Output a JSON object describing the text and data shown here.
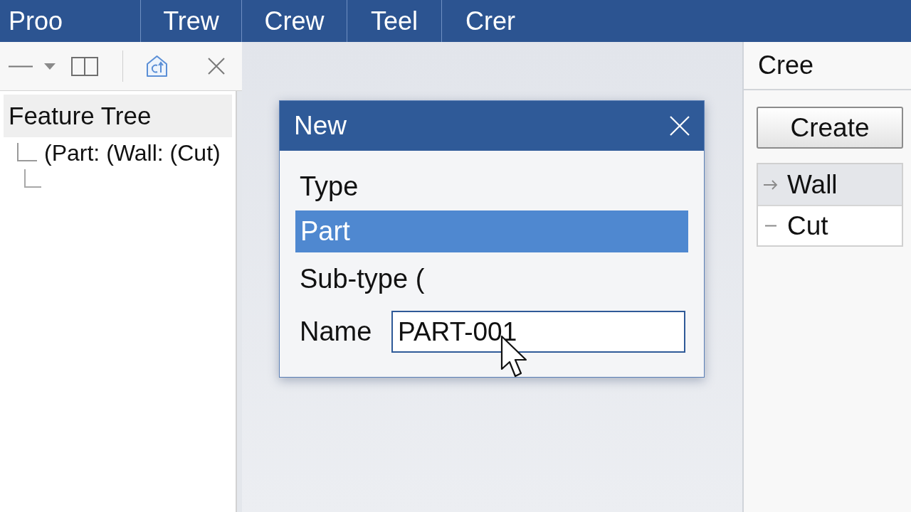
{
  "menu_bar": {
    "items": [
      {
        "label": "Proo"
      },
      {
        "label": "Trew"
      },
      {
        "label": "Crew"
      },
      {
        "label": "Teel"
      },
      {
        "label": "Crer"
      }
    ]
  },
  "feature_tree": {
    "title": "Feature Tree",
    "items": [
      {
        "label": "(Part: (Wall: (Cut)"
      }
    ]
  },
  "dialog": {
    "title": "New",
    "type": {
      "label": "Type",
      "options": [
        {
          "label": "Part",
          "selected": true
        }
      ]
    },
    "subtype": {
      "label": "Sub-type ("
    },
    "name": {
      "label": "Name",
      "value": "PART-001"
    }
  },
  "right_panel": {
    "title": "Cree",
    "button": "Create",
    "items": [
      {
        "label": "Wall",
        "selected": true
      },
      {
        "label": "Cut",
        "selected": false
      }
    ]
  }
}
